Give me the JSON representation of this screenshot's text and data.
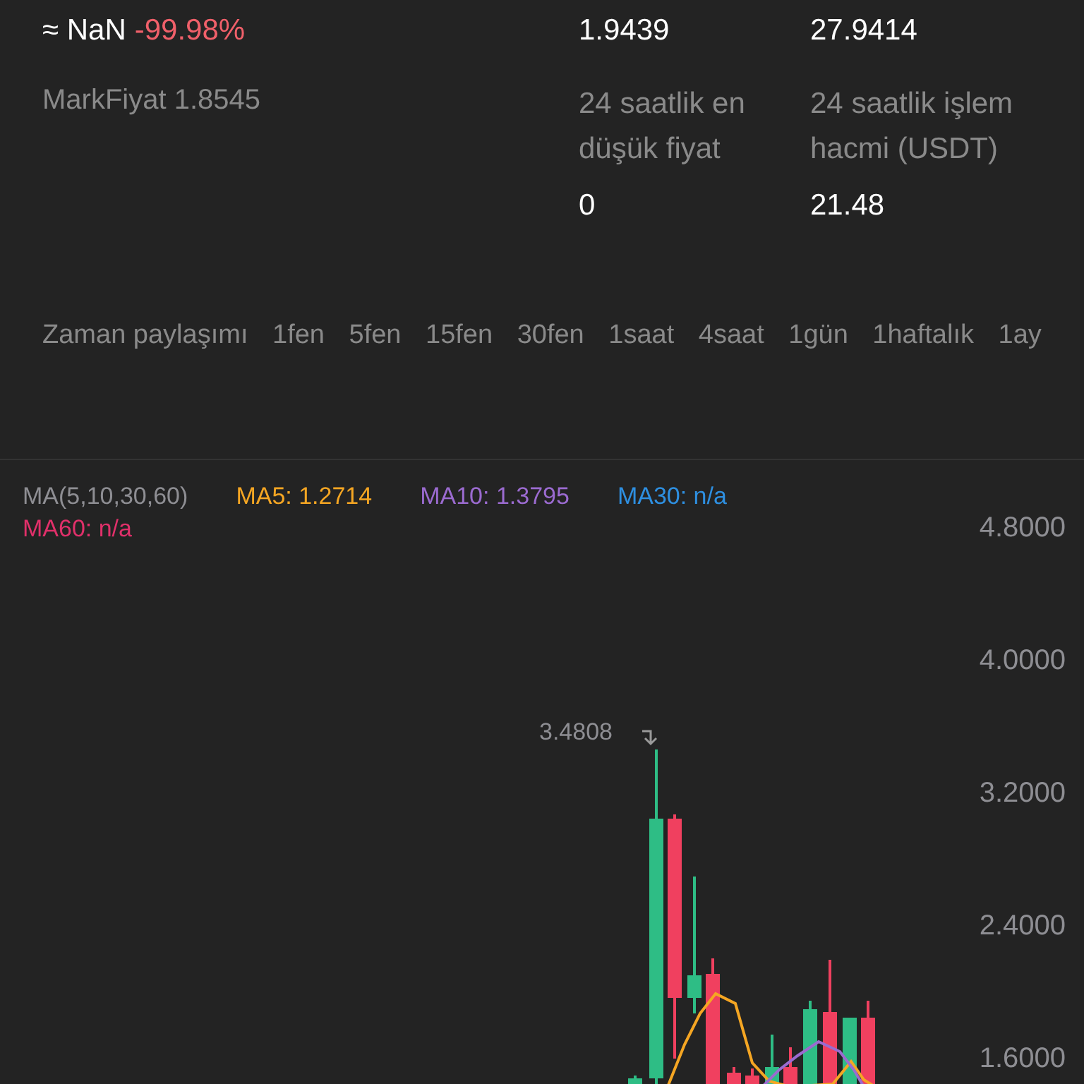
{
  "price": {
    "approx": "≈ NaN",
    "change": "-99.98%",
    "mark": "MarkFiyat 1.8545"
  },
  "stats": [
    {
      "value": "1.9439"
    },
    {
      "value": "27.9414"
    },
    {
      "label": "24 saatlik en düşük fiyat",
      "value": "0"
    },
    {
      "label": "24 saatlik işlem hacmi (USDT)",
      "value": "21.48"
    }
  ],
  "timeframes": [
    "Zaman paylaşımı",
    "1fen",
    "5fen",
    "15fen",
    "30fen",
    "1saat",
    "4saat",
    "1gün",
    "1haftalık",
    "1ay"
  ],
  "chart": {
    "legend": [
      {
        "text": "MA(5,10,30,60)",
        "color": "#8e8e93"
      },
      {
        "text": "MA5: 1.2714",
        "color": "#f5a623"
      },
      {
        "text": "MA10: 1.3795",
        "color": "#9b6bd0"
      },
      {
        "text": "MA30: n/a",
        "color": "#2e8fe0"
      },
      {
        "text": "MA60: n/a",
        "color": "#e0306a"
      }
    ],
    "y_labels": [
      "4.8000",
      "4.0000",
      "3.2000",
      "2.4000",
      "1.6000"
    ],
    "high_marker": "3.4808"
  }
}
